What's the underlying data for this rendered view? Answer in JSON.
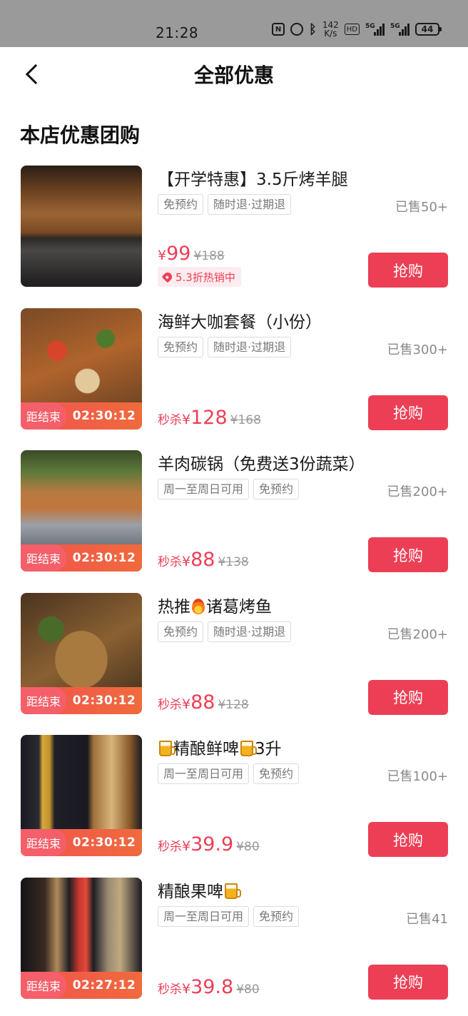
{
  "status_bar": {
    "time": "21:28",
    "net_speed_value": "142",
    "net_speed_unit": "K/s",
    "hd": "HD",
    "sim1": "5G",
    "sim2": "5G",
    "battery": "44"
  },
  "header": {
    "title": "全部优惠",
    "back_icon": "chevron-left-icon"
  },
  "section": {
    "title": "本店优惠团购"
  },
  "deals": [
    {
      "title": "【开学特惠】3.5斤烤羊腿",
      "tags": [
        "免预约",
        "随时退·过期退"
      ],
      "sold": "已售50+",
      "price_prefix": "",
      "currency": "¥",
      "price": "99",
      "original_price": "¥188",
      "discount": "5.3折热销中",
      "countdown_label": "",
      "countdown": "",
      "buy_label": "抢购",
      "photo_colors": [
        "#3a2a1e",
        "#8a5a32",
        "#2a2522"
      ]
    },
    {
      "title": "海鲜大咖套餐（小份）",
      "tags": [
        "免预约",
        "随时退·过期退"
      ],
      "sold": "已售300+",
      "price_prefix": "秒杀",
      "currency": "¥",
      "price": "128",
      "original_price": "¥168",
      "countdown_label": "距结束",
      "countdown": "02:30:12",
      "buy_label": "抢购",
      "photo_colors": [
        "#6a4a2a",
        "#c8632c",
        "#3e5a2a"
      ]
    },
    {
      "title": "羊肉碳锅（免费送3份蔬菜）",
      "tags": [
        "周一至周日可用",
        "免预约"
      ],
      "sold": "已售200+",
      "price_prefix": "秒杀",
      "currency": "¥",
      "price": "88",
      "original_price": "¥138",
      "countdown_label": "距结束",
      "countdown": "02:30:12",
      "buy_label": "抢购",
      "photo_colors": [
        "#4a6a3a",
        "#c0763c",
        "#8a8e94"
      ]
    },
    {
      "title_before": "热推",
      "title_after": "诸葛烤鱼",
      "title_icon": "fire-icon",
      "tags": [
        "免预约",
        "随时退·过期退"
      ],
      "sold": "已售200+",
      "price_prefix": "秒杀",
      "currency": "¥",
      "price": "88",
      "original_price": "¥128",
      "countdown_label": "距结束",
      "countdown": "02:30:12",
      "buy_label": "抢购",
      "photo_colors": [
        "#5a4226",
        "#b07a3c",
        "#3a4a26"
      ]
    },
    {
      "title_mid": "精酿鲜啤",
      "title_after": "3升",
      "title_icon": "beer-mug-icon",
      "tags": [
        "周一至周日可用",
        "免预约"
      ],
      "sold": "已售100+",
      "price_prefix": "秒杀",
      "currency": "¥",
      "price": "39.9",
      "original_price": "¥80",
      "countdown_label": "距结束",
      "countdown": "02:30:12",
      "buy_label": "抢购",
      "photo_colors": [
        "#1e1e26",
        "#d2a23a",
        "#8a5a2a"
      ]
    },
    {
      "title_before": "精酿果啤",
      "title_icon": "beer-mug-icon",
      "tags": [
        "周一至周日可用",
        "免预约"
      ],
      "sold": "已售41",
      "price_prefix": "秒杀",
      "currency": "¥",
      "price": "39.8",
      "original_price": "¥80",
      "countdown_label": "距结束",
      "countdown": "02:27:12",
      "buy_label": "抢购",
      "photo_colors": [
        "#1a1a22",
        "#c8382e",
        "#b08a5a"
      ]
    }
  ],
  "colors": {
    "accent": "#ec3f56",
    "status_bar_bg": "#9a9a9a",
    "countdown_gradient": [
      "#f2534f",
      "#ef6a3c"
    ]
  }
}
